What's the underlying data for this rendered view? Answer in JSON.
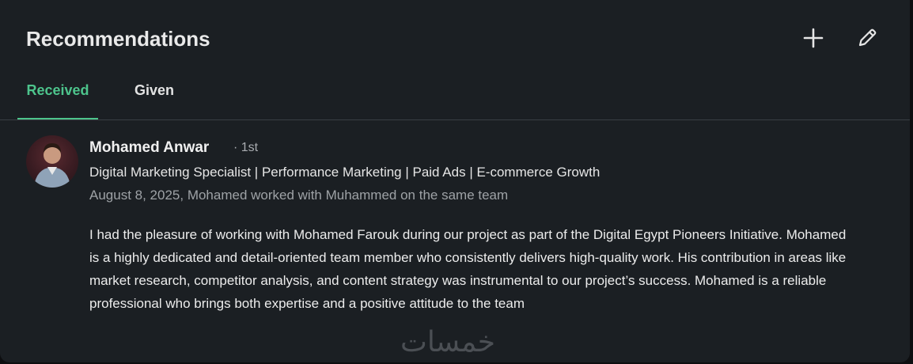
{
  "section": {
    "title": "Recommendations",
    "add_icon": "plus-icon",
    "edit_icon": "pencil-icon"
  },
  "tabs": [
    {
      "label": "Received",
      "active": true
    },
    {
      "label": "Given",
      "active": false
    }
  ],
  "recommendation": {
    "name": "Mohamed Anwar",
    "degree": "· 1st",
    "headline": "Digital Marketing Specialist | Performance Marketing | Paid Ads | E-commerce Growth",
    "meta": "August 8, 2025, Mohamed worked with Muhammed on the same team",
    "body": "I had the pleasure of working with Mohamed Farouk during our project as part of the Digital Egypt Pioneers Initiative. Mohamed is a highly dedicated and detail-oriented team member who consistently delivers high-quality work. His contribution in areas like market research, competitor analysis, and content strategy was instrumental to our project’s success. Mohamed is a reliable professional who brings both expertise and a positive attitude to the team"
  },
  "watermark": "خمسات",
  "colors": {
    "accent": "#4dc48c",
    "card_bg": "#1b1f23",
    "page_bg": "#0d0e10"
  }
}
